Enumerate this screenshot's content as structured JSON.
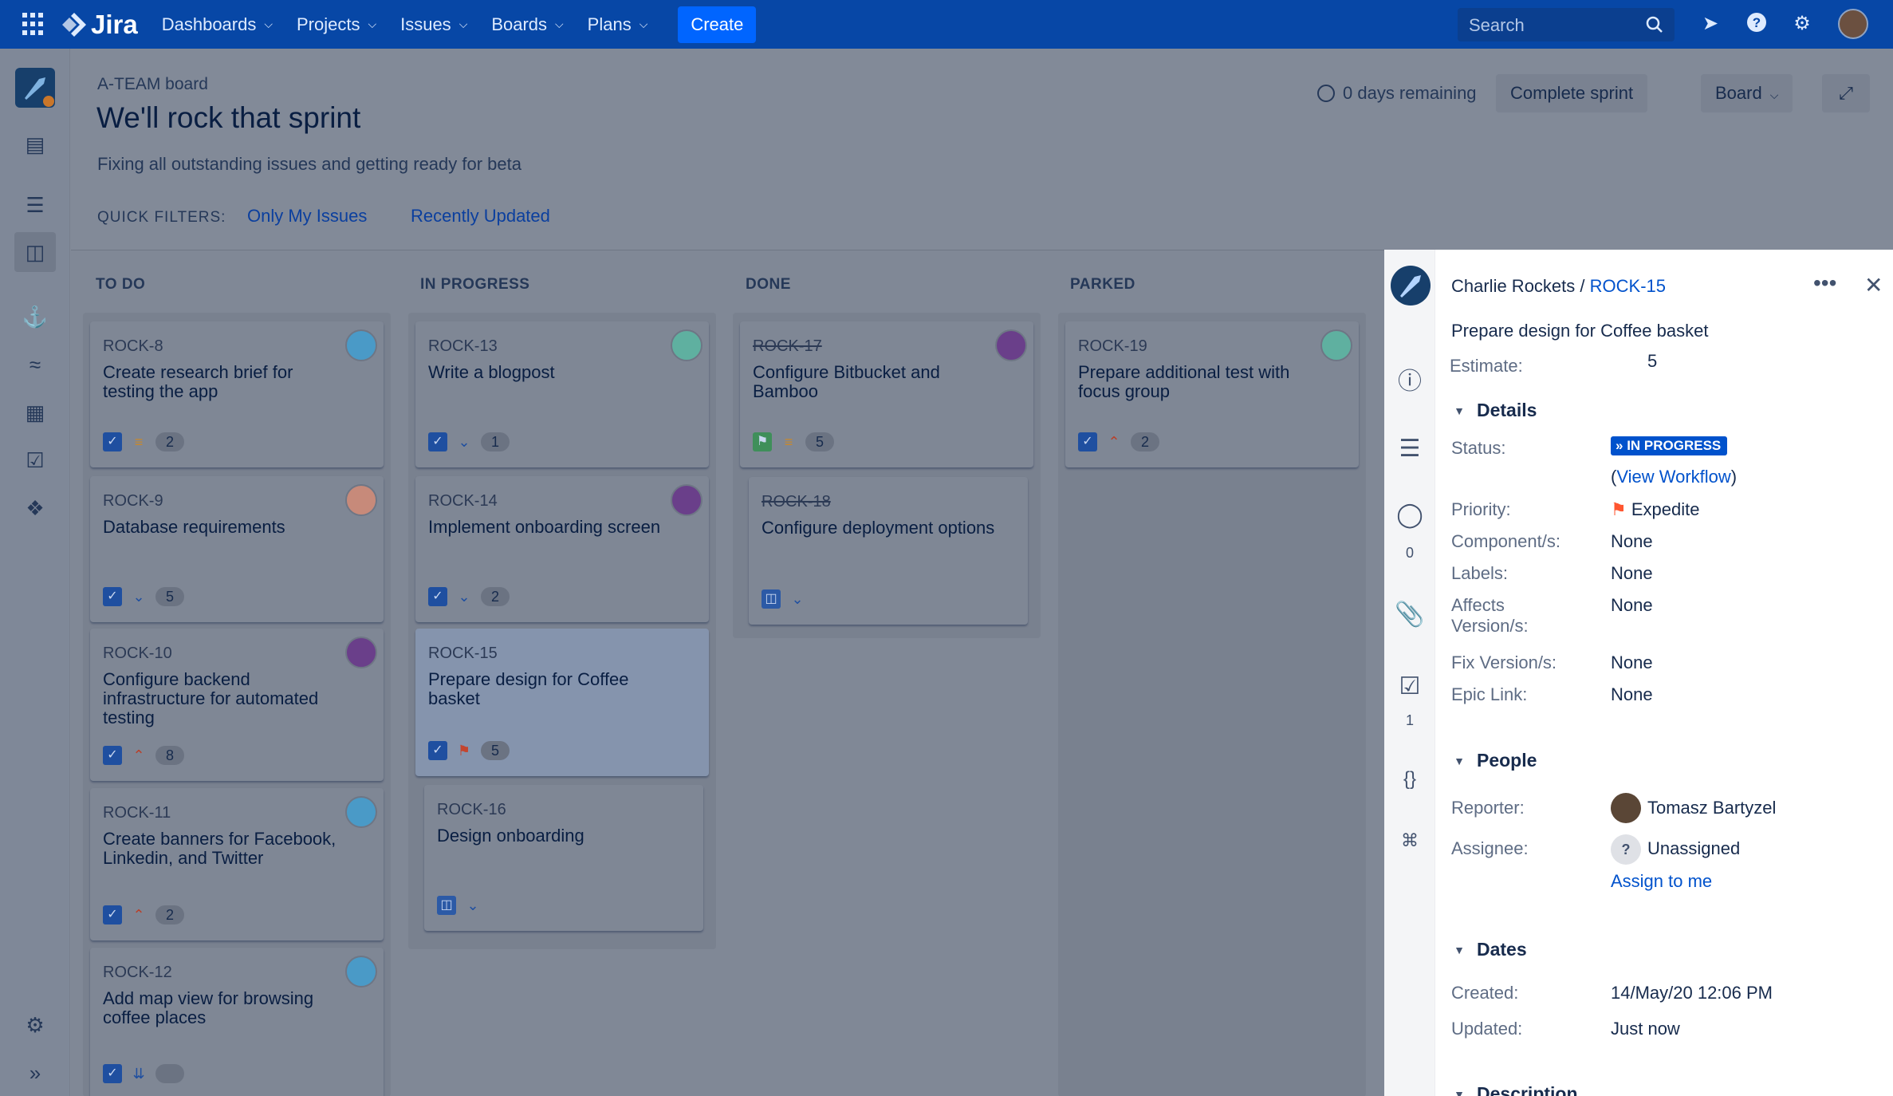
{
  "topbar": {
    "product": "Jira",
    "nav": [
      {
        "label": "Dashboards"
      },
      {
        "label": "Projects"
      },
      {
        "label": "Issues"
      },
      {
        "label": "Boards"
      },
      {
        "label": "Plans"
      }
    ],
    "create_label": "Create",
    "search_placeholder": "Search"
  },
  "header": {
    "board_name": "A-TEAM board",
    "sprint_name": "We'll rock that sprint",
    "sprint_goal": "Fixing all outstanding issues and getting ready for beta",
    "quick_filters_label": "QUICK FILTERS:",
    "quick_filters": [
      "Only My Issues",
      "Recently Updated"
    ],
    "days_remaining": "0 days remaining",
    "complete_sprint_label": "Complete sprint",
    "board_menu_label": "Board"
  },
  "columns": [
    {
      "title": "TO DO",
      "cards": [
        {
          "key": "ROCK-8",
          "summary": "Create research brief for testing the app",
          "priority": "medium",
          "points": "2"
        },
        {
          "key": "ROCK-9",
          "summary": "Database requirements",
          "priority": "low",
          "points": "5"
        },
        {
          "key": "ROCK-10",
          "summary": "Configure backend infrastructure for automated testing",
          "priority": "highest",
          "points": "8"
        },
        {
          "key": "ROCK-11",
          "summary": "Create banners for Facebook, Linkedin, and Twitter",
          "priority": "high",
          "points": "2"
        },
        {
          "key": "ROCK-12",
          "summary": "Add map view for browsing coffee places",
          "priority": "lowest",
          "points": ""
        }
      ]
    },
    {
      "title": "IN PROGRESS",
      "cards": [
        {
          "key": "ROCK-13",
          "summary": "Write a blogpost",
          "priority": "low",
          "points": "1"
        },
        {
          "key": "ROCK-14",
          "summary": "Implement onboarding screen",
          "priority": "low",
          "points": "2"
        },
        {
          "key": "ROCK-15",
          "summary": "Prepare design for Coffee basket",
          "priority": "expedite",
          "points": "5"
        },
        {
          "key": "ROCK-16",
          "summary": "Design onboarding",
          "priority": "low",
          "points": ""
        }
      ]
    },
    {
      "title": "DONE",
      "cards": [
        {
          "key": "ROCK-17",
          "summary": "Configure Bitbucket and Bamboo",
          "priority": "medium",
          "points": "5"
        },
        {
          "key": "ROCK-18",
          "summary": "Configure deployment options",
          "priority": "low",
          "points": ""
        }
      ]
    },
    {
      "title": "PARKED",
      "cards": [
        {
          "key": "ROCK-19",
          "summary": "Prepare additional test with focus group",
          "priority": "highest",
          "points": "2"
        }
      ]
    }
  ],
  "detail": {
    "project": "Charlie Rockets",
    "separator": "/",
    "issue_key": "ROCK-15",
    "summary": "Prepare design for Coffee basket",
    "estimate_label": "Estimate:",
    "estimate": "5",
    "details_heading": "Details",
    "status_label": "Status:",
    "status": "IN PROGRESS",
    "view_workflow": "View Workflow",
    "priority_label": "Priority:",
    "priority": "Expedite",
    "components_label": "Component/s:",
    "components": "None",
    "labels_label": "Labels:",
    "labels": "None",
    "affects_label_1": "Affects",
    "affects_label_2": "Version/s:",
    "affects": "None",
    "fix_label": "Fix Version/s:",
    "fix": "None",
    "epic_label": "Epic Link:",
    "epic": "None",
    "people_heading": "People",
    "reporter_label": "Reporter:",
    "reporter": "Tomasz Bartyzel",
    "assignee_label": "Assignee:",
    "assignee": "Unassigned",
    "assign_to_me": "Assign to me",
    "dates_heading": "Dates",
    "created_label": "Created:",
    "created": "14/May/20 12:06 PM",
    "updated_label": "Updated:",
    "updated": "Just now",
    "description_heading": "Description",
    "comments_count": "0",
    "subtasks_count": "1"
  },
  "colors": {
    "topbar": "#0747a6",
    "link": "#0052cc",
    "status_lozenge": "#0052cc",
    "expedite": "#ff5630"
  }
}
